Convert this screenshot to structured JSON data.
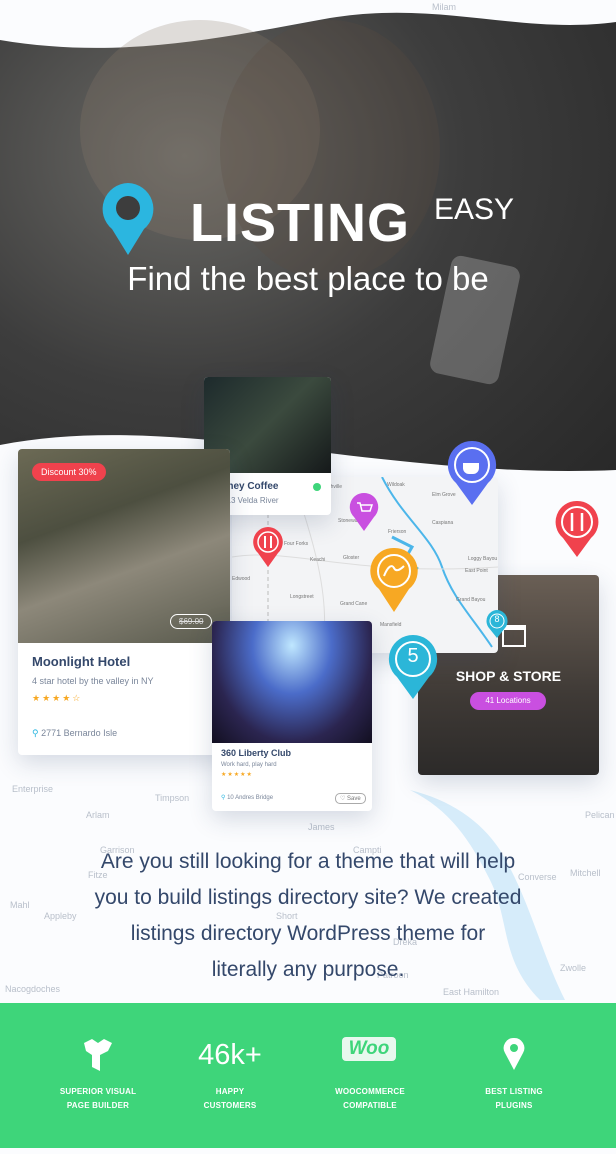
{
  "brand": {
    "name": "LISTING",
    "suffix": "EASY",
    "tagline": "Find the best place to be",
    "accent": "#2bb6e0"
  },
  "map_labels": [
    "Milam",
    "Enterprise",
    "Timpson",
    "Arlam",
    "James",
    "Garrison",
    "Fitze",
    "Mahl",
    "Appleby",
    "Short",
    "Campti",
    "Converse",
    "Mitchell",
    "Pelican",
    "Zwolle",
    "East Hamilton",
    "Nacogdoches",
    "Dreka",
    "Patroon"
  ],
  "inner_map_labels": [
    "Keithville",
    "Stonewall",
    "Four Forks",
    "Keachi",
    "Gloster",
    "Longstreet",
    "Grand Cane",
    "Mansfield",
    "Frierson",
    "Wildoak",
    "Elm Grove",
    "Caspiana",
    "Loggy Bayou",
    "East Point",
    "Grand Bayou",
    "Edwood"
  ],
  "hotel": {
    "badge": "Discount 30%",
    "old_price": "$69.00",
    "title": "Moonlight Hotel",
    "subtitle": "4 star hotel by the valley in NY",
    "rating": 4,
    "max_rating": 5,
    "address": "2771 Bernardo Isle"
  },
  "coffee": {
    "title": "Honey Coffee",
    "address": "313 Velda River"
  },
  "club": {
    "title": "360 Liberty Club",
    "subtitle": "Work hard, play hard",
    "rating": 5,
    "address": "10 Andres Bridge",
    "save": "Save"
  },
  "shop": {
    "title": "SHOP & STORE",
    "count": "41 Locations"
  },
  "pins": {
    "cluster_5": "5",
    "cluster_8": "8"
  },
  "description": [
    "Are you still looking for a theme that will help",
    "you to build listings directory site? We created",
    "listings directory WordPress theme for",
    "literally any purpose."
  ],
  "features": [
    {
      "icon": "page-builder-icon",
      "label1": "SUPERIOR VISUAL",
      "label2": "PAGE BUILDER"
    },
    {
      "stat": "46k+",
      "label1": "HAPPY",
      "label2": "CUSTOMERS"
    },
    {
      "icon": "woocommerce-icon",
      "logo_text": "Woo",
      "label1": "WOOCOMMERCE",
      "label2": "COMPATIBLE"
    },
    {
      "icon": "map-pin-icon",
      "label1": "BEST LISTING",
      "label2": "PLUGINS"
    }
  ],
  "colors": {
    "green": "#3ed57a",
    "red": "#f0424d",
    "purple": "#c94fe0",
    "blue": "#5a6ff0",
    "orange": "#f7a823",
    "teal": "#2bb6d8",
    "text": "#34486b"
  }
}
